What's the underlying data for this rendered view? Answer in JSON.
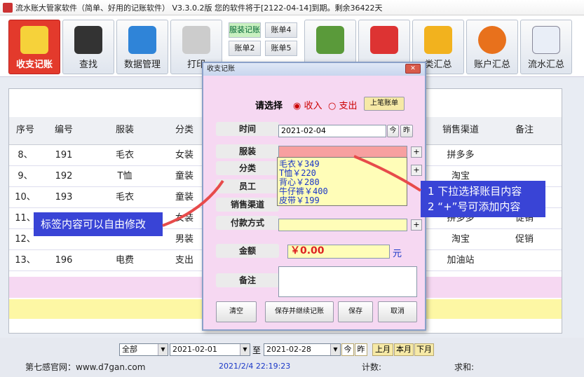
{
  "window": {
    "title": "流水账大管家软件（简单、好用的记账软件） V3.3.0.2版 您的软件将于[2122-04-14]到期。剩余36422天"
  },
  "toolbar": {
    "buttons": [
      {
        "label": "收支记账"
      },
      {
        "label": "查找"
      },
      {
        "label": "数据管理"
      },
      {
        "label": "打印"
      },
      {
        "label": "类汇总"
      },
      {
        "label": "账户汇总"
      },
      {
        "label": "流水汇总"
      }
    ],
    "small": [
      {
        "label": "服装记账"
      },
      {
        "label": "账单4"
      },
      {
        "label": "账单2"
      },
      {
        "label": "账单5"
      }
    ]
  },
  "grid": {
    "headers": [
      "序号",
      "编号",
      "服装",
      "分类",
      "销售渠道",
      "备注"
    ],
    "rows": [
      [
        "8、",
        "191",
        "毛衣",
        "女装",
        "拼多多",
        ""
      ],
      [
        "9、",
        "192",
        "T恤",
        "童装",
        "淘宝",
        ""
      ],
      [
        "10、",
        "193",
        "毛衣",
        "童装",
        "",
        ""
      ],
      [
        "11、",
        "",
        "",
        "女装",
        "拼多多",
        "促销"
      ],
      [
        "12、",
        "",
        "",
        "男装",
        "淘宝",
        "促销"
      ],
      [
        "13、",
        "196",
        "电费",
        "支出",
        "加油站",
        ""
      ]
    ]
  },
  "dialog": {
    "title": "收支记账",
    "choose_label": "请选择",
    "income": "收入",
    "expense": "支出",
    "prev_button": "上笔账单",
    "labels": {
      "time": "时间",
      "clothing": "服装",
      "category": "分类",
      "staff": "员工",
      "channel": "销售渠道",
      "payment": "付款方式",
      "amount": "金额",
      "memo": "备注"
    },
    "date": "2021-02-04",
    "today": "今",
    "yesterday": "昨",
    "amount": "￥0.00",
    "unit": "元",
    "dropdown": [
      "毛衣￥349",
      "T恤￥220",
      "背心￥280",
      "牛仔裤￥400",
      "皮带￥199"
    ],
    "buttons": {
      "clear": "清空",
      "save_continue": "保存并继续记账",
      "save": "保存",
      "cancel": "取消"
    }
  },
  "notes": {
    "left": "标签内容可以自由修改",
    "right1": "1 下拉选择账目内容",
    "right2": "2 “+”号可添加内容"
  },
  "footer": {
    "filter": "全部",
    "from": "2021-02-01",
    "to_label": "至",
    "to": "2021-02-28",
    "today": "今",
    "yesterday": "昨",
    "month_prev": "上月",
    "month_this": "本月",
    "month_next": "下月",
    "site": "第七感官网：www.d7gan.com",
    "datetime": "2021/2/4 22:19:23",
    "count_label": "计数:",
    "sum_label": "求和:"
  },
  "colors": {
    "accent": "#e33a2c",
    "dialog": "#f6d8f2",
    "note": "#3944d6"
  }
}
